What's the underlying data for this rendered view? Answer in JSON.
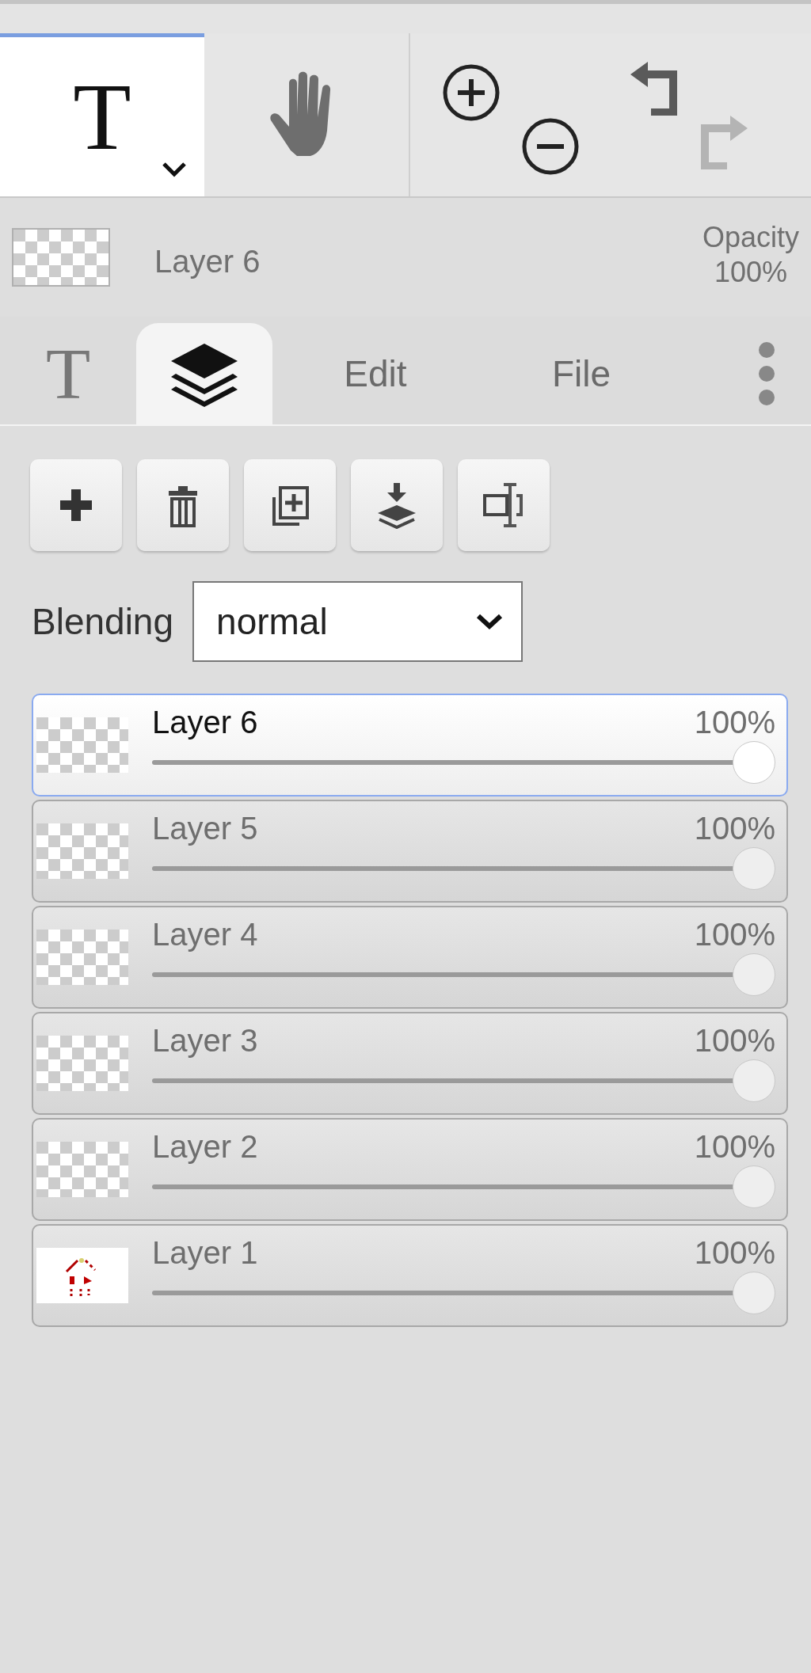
{
  "toolbar": {
    "tools": [
      {
        "kind": "text",
        "glyph": "T",
        "selected": true
      },
      {
        "kind": "hand",
        "selected": false
      }
    ],
    "history": [
      {
        "kind": "undo",
        "disabled": false
      },
      {
        "kind": "redo",
        "disabled": true
      }
    ]
  },
  "current_layer": {
    "name": "Layer 6",
    "opacity_label": "Opacity",
    "opacity": "100%"
  },
  "tabs": [
    {
      "kind": "text",
      "glyph": "T",
      "selected": false
    },
    {
      "kind": "layers",
      "selected": true
    },
    {
      "kind": "label",
      "label": "Edit",
      "selected": false
    },
    {
      "kind": "label",
      "label": "File",
      "selected": false
    },
    {
      "kind": "more",
      "selected": false
    }
  ],
  "layer_actions": [
    {
      "kind": "add"
    },
    {
      "kind": "delete"
    },
    {
      "kind": "duplicate"
    },
    {
      "kind": "merge"
    },
    {
      "kind": "rename"
    }
  ],
  "blending": {
    "label": "Blending",
    "value": "normal"
  },
  "layers": [
    {
      "name": "Layer 6",
      "opacity": "100%",
      "level": 1,
      "selected": true,
      "kind": "transparent"
    },
    {
      "name": "Layer 5",
      "opacity": "100%",
      "level": 1,
      "selected": false,
      "kind": "transparent"
    },
    {
      "name": "Layer 4",
      "opacity": "100%",
      "level": 1,
      "selected": false,
      "kind": "transparent"
    },
    {
      "name": "Layer 3",
      "opacity": "100%",
      "level": 1,
      "selected": false,
      "kind": "transparent"
    },
    {
      "name": "Layer 2",
      "opacity": "100%",
      "level": 1,
      "selected": false,
      "kind": "transparent"
    },
    {
      "name": "Layer 1",
      "opacity": "100%",
      "level": 1,
      "selected": false,
      "kind": "drawing"
    }
  ]
}
